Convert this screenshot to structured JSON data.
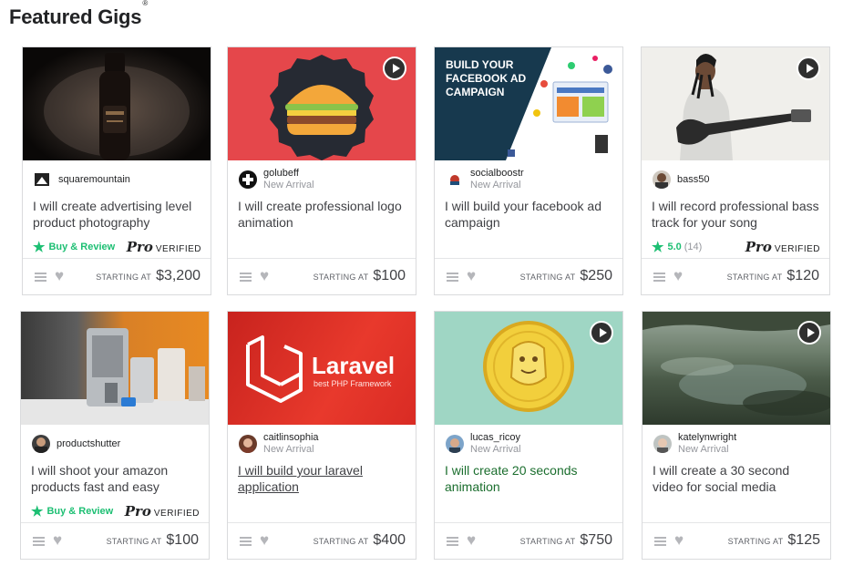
{
  "page": {
    "title": "Featured Gigs",
    "title_mark": "®"
  },
  "gigs": [
    {
      "seller": "squaremountain",
      "level": "",
      "title": "I will create advertising level product photography",
      "rating_label": "Buy & Review",
      "rating_count": "",
      "pro_mark": "Pro",
      "pro_verified": "VERIFIED",
      "starting_label": "STARTING AT",
      "price": "$3,200"
    },
    {
      "seller": "golubeff",
      "level": "New Arrival",
      "title": "I will create professional logo animation",
      "starting_label": "STARTING AT",
      "price": "$100"
    },
    {
      "seller": "socialboostr",
      "level": "New Arrival",
      "title": "I will build your facebook ad campaign",
      "thumb_text": "BUILD YOUR FACEBOOK AD CAMPAIGN",
      "starting_label": "STARTING AT",
      "price": "$250"
    },
    {
      "seller": "bass50",
      "level": "",
      "title": "I will record professional bass track for your song",
      "rating_label": "5.0",
      "rating_count": "(14)",
      "pro_mark": "Pro",
      "pro_verified": "VERIFIED",
      "starting_label": "STARTING AT",
      "price": "$120"
    },
    {
      "seller": "productshutter",
      "level": "",
      "title": "I will shoot your amazon products fast and easy",
      "rating_label": "Buy & Review",
      "rating_count": "",
      "pro_mark": "Pro",
      "pro_verified": "VERIFIED",
      "starting_label": "STARTING AT",
      "price": "$100"
    },
    {
      "seller": "caitlinsophia",
      "level": "New Arrival",
      "title": "I will build your laravel application",
      "thumb_text": "Laravel",
      "thumb_subtext": "best PHP Framework",
      "starting_label": "STARTING AT",
      "price": "$400"
    },
    {
      "seller": "lucas_ricoy",
      "level": "New Arrival",
      "title": "I will create 20 seconds animation",
      "starting_label": "STARTING AT",
      "price": "$750"
    },
    {
      "seller": "katelynwright",
      "level": "New Arrival",
      "title": "I will create a 30 second video for social media",
      "starting_label": "STARTING AT",
      "price": "$125"
    }
  ],
  "colors": {
    "accent": "#1dbf73",
    "border": "#dadbdd",
    "text": "#404145",
    "muted": "#95979d"
  },
  "icons": {
    "menu": "menu-icon",
    "favorite": "heart-icon",
    "play": "play-icon",
    "star": "star-icon"
  }
}
